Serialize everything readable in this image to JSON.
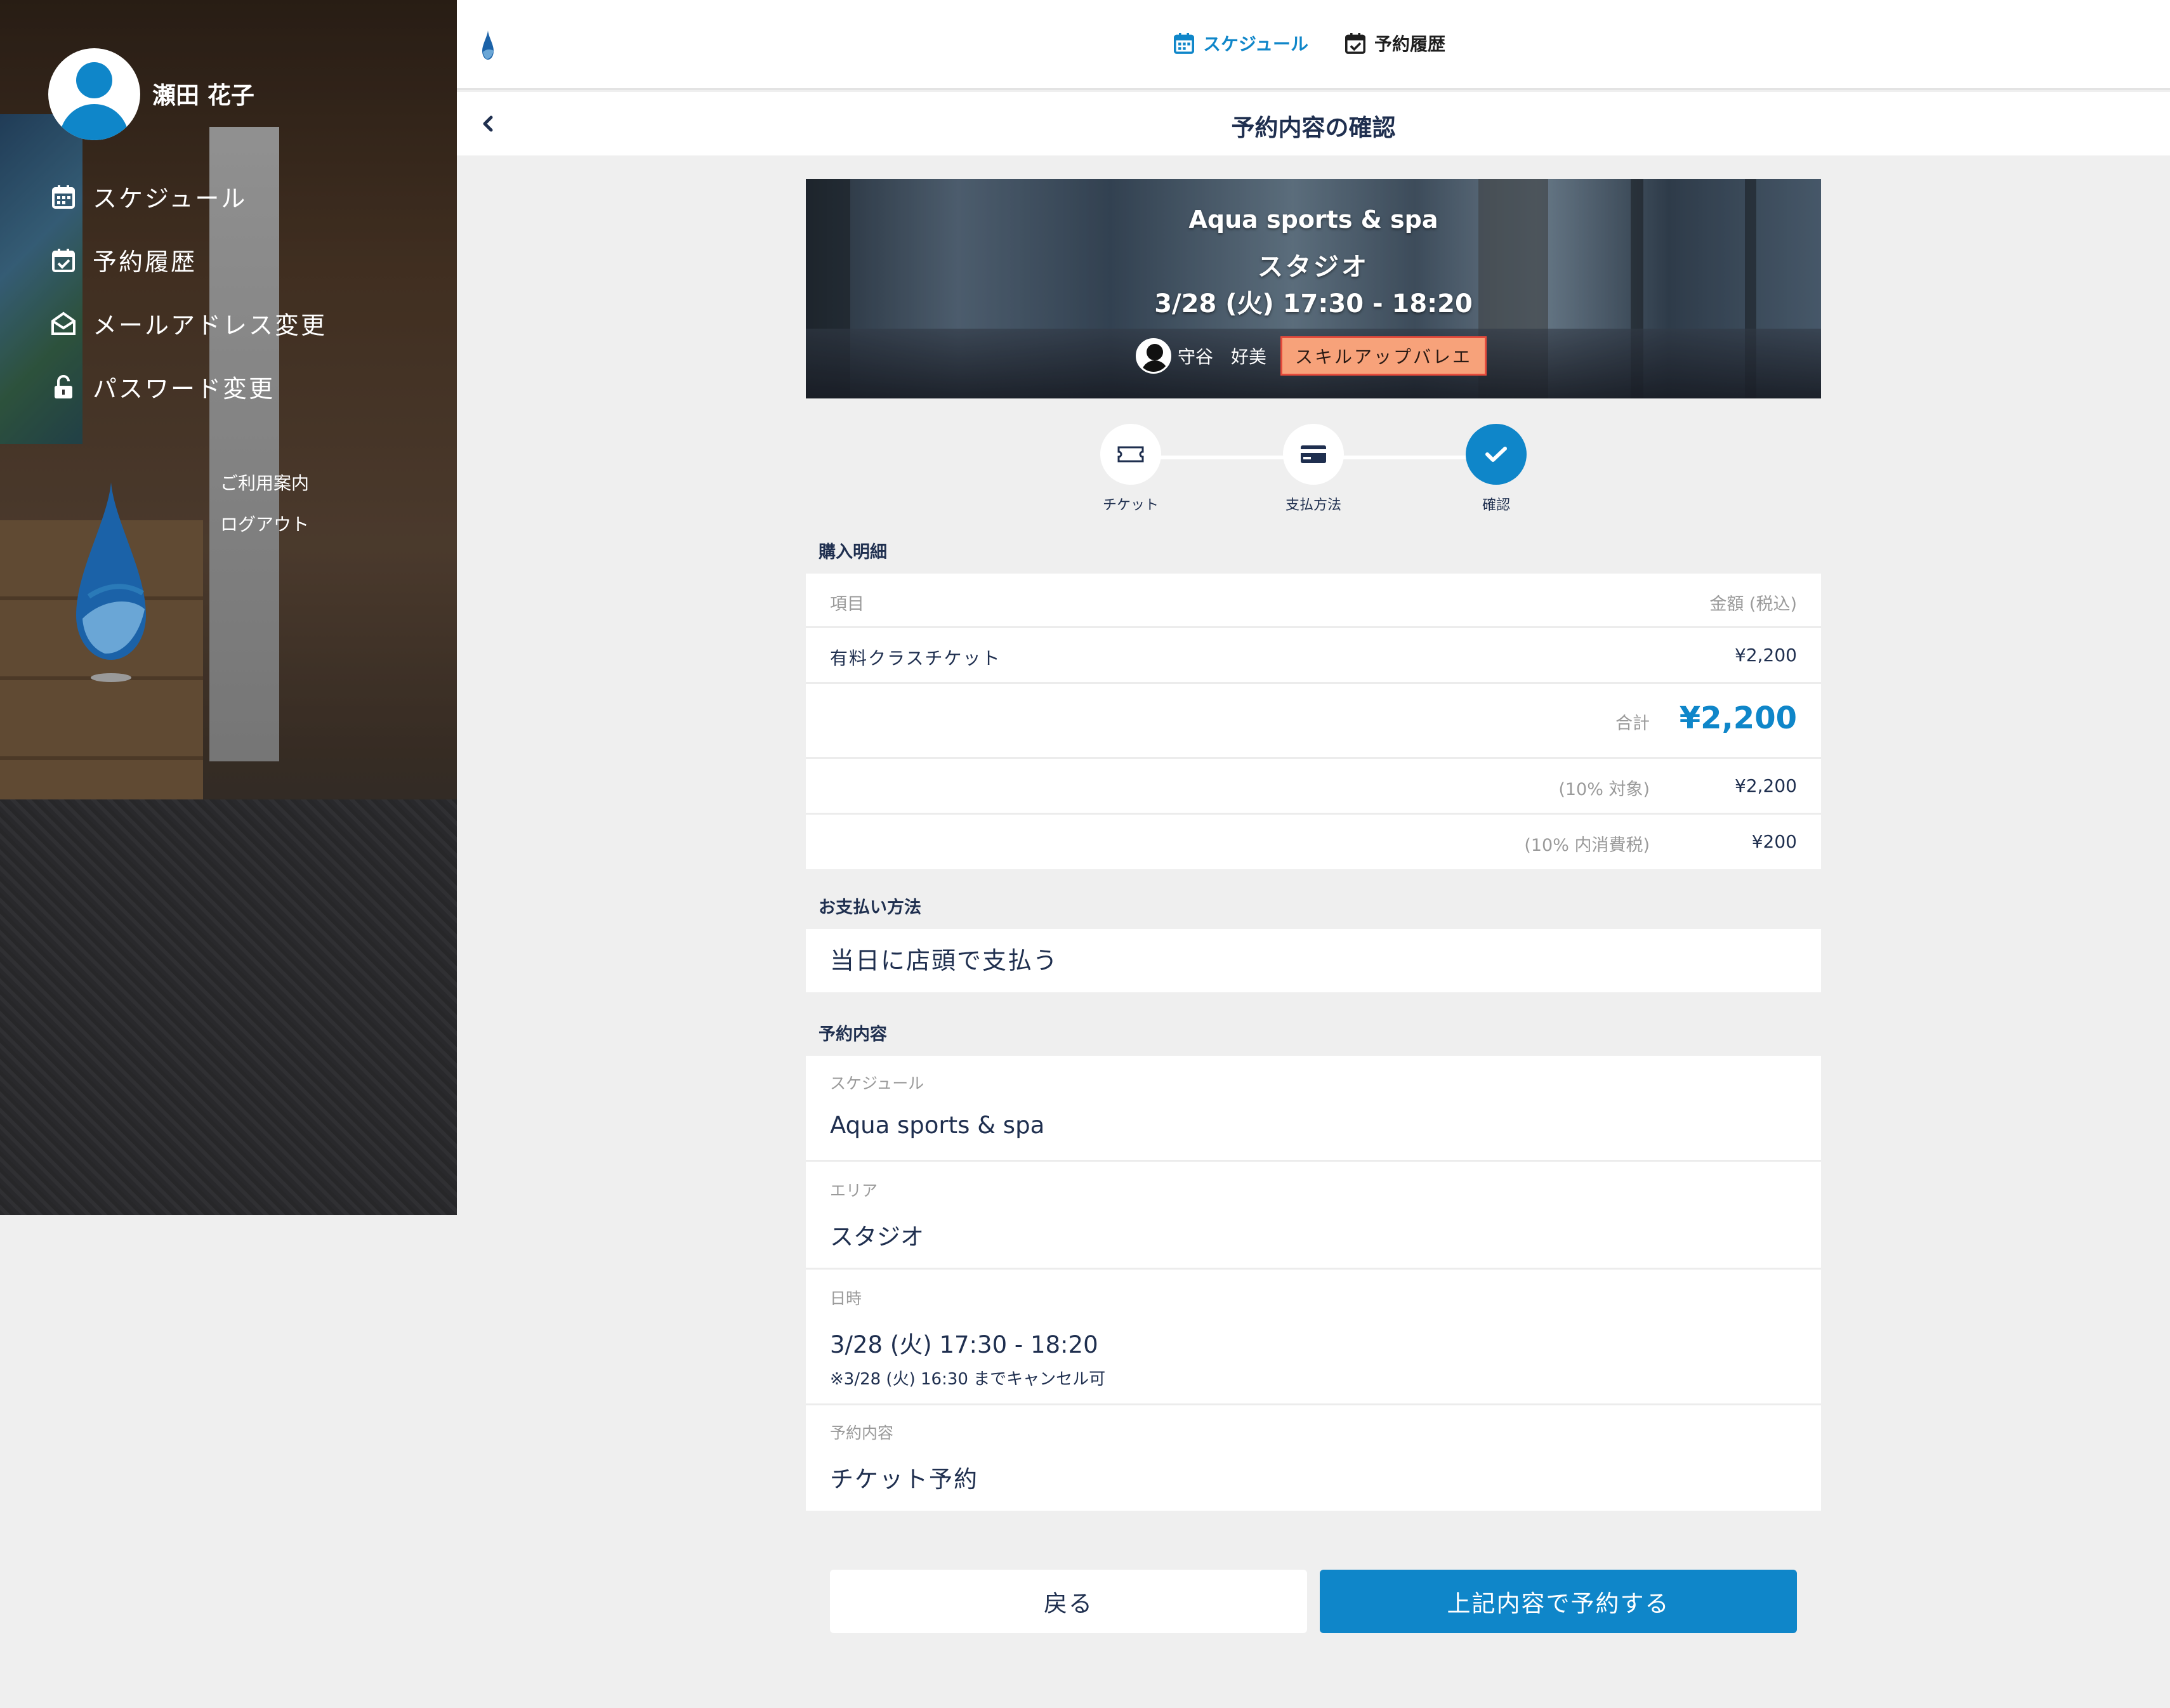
{
  "sidebar": {
    "user_name": "瀬田 花子",
    "menu": [
      {
        "label": "スケジュール",
        "icon": "calendar-icon"
      },
      {
        "label": "予約履歴",
        "icon": "calendar-check-icon"
      },
      {
        "label": "メールアドレス変更",
        "icon": "envelope-open-icon"
      },
      {
        "label": "パスワード変更",
        "icon": "unlock-icon"
      }
    ],
    "links": [
      "ご利用案内",
      "ログアウト"
    ]
  },
  "topnav": {
    "schedule": "スケジュール",
    "history": "予約履歴"
  },
  "titlebar": {
    "title": "予約内容の確認"
  },
  "hero": {
    "facility": "Aqua sports & spa",
    "area": "スタジオ",
    "datetime": "3/28 (火) 17:30 - 18:20",
    "instructor": "守谷　好美",
    "program": "スキルアップバレエ"
  },
  "steps": [
    {
      "label": "チケット",
      "icon": "ticket-icon"
    },
    {
      "label": "支払方法",
      "icon": "credit-card-icon"
    },
    {
      "label": "確認",
      "icon": "check-icon"
    }
  ],
  "purchase": {
    "heading": "購入明細",
    "col_item": "項目",
    "col_amount": "金額 (税込)",
    "item_name": "有料クラスチケット",
    "item_price": "¥2,200",
    "total_label": "合計",
    "total_value": "¥2,200",
    "taxable_label": "(10% 対象)",
    "taxable_value": "¥2,200",
    "tax_label": "(10% 内消費税)",
    "tax_value": "¥200"
  },
  "payment": {
    "heading": "お支払い方法",
    "method": "当日に店頭で支払う"
  },
  "reservation": {
    "heading": "予約内容",
    "schedule_label": "スケジュール",
    "schedule_value": "Aqua sports & spa",
    "area_label": "エリア",
    "area_value": "スタジオ",
    "datetime_label": "日時",
    "datetime_value": "3/28 (火) 17:30 - 18:20",
    "cancel_note": "※3/28 (火) 16:30 までキャンセル可",
    "type_label": "予約内容",
    "type_value": "チケット予約"
  },
  "buttons": {
    "back": "戻る",
    "confirm": "上記内容で予約する"
  },
  "colors": {
    "accent": "#0f86c9",
    "text": "#1f2f4f",
    "tag_bg": "#f7a27a",
    "tag_border": "#e64a3b",
    "bg": "#efefef"
  }
}
